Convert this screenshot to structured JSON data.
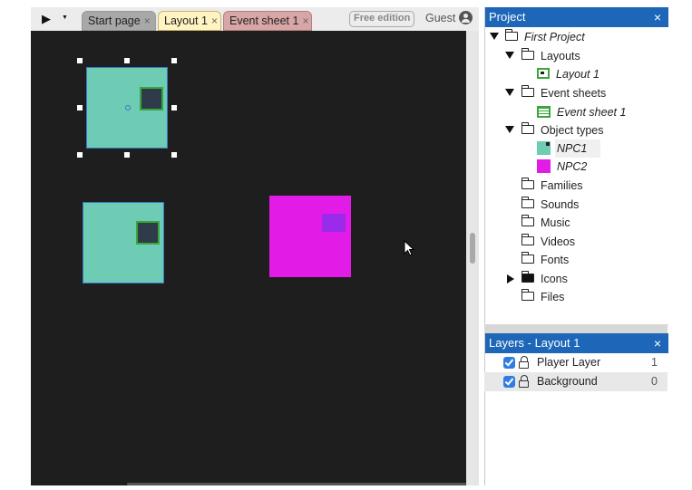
{
  "toolbar": {
    "tabs": [
      {
        "label": "Start page"
      },
      {
        "label": "Layout 1"
      },
      {
        "label": "Event sheet 1"
      }
    ],
    "close_glyph": "×",
    "edition_badge": "Free edition",
    "user": "Guest"
  },
  "project": {
    "title": "Project",
    "close_glyph": "×",
    "root": "First Project",
    "layouts": "Layouts",
    "layout_item": "Layout 1",
    "event_sheets": "Event sheets",
    "event_sheet_item": "Event sheet 1",
    "object_types": "Object types",
    "npc1": "NPC1",
    "npc2": "NPC2",
    "families": "Families",
    "sounds": "Sounds",
    "music": "Music",
    "videos": "Videos",
    "fonts": "Fonts",
    "icons": "Icons",
    "files": "Files"
  },
  "layers": {
    "title": "Layers - Layout 1",
    "close_glyph": "×",
    "items": [
      {
        "name": "Player Layer",
        "index": "1"
      },
      {
        "name": "Background",
        "index": "0"
      }
    ]
  },
  "colors": {
    "npc1": "#6ecbb4",
    "npc2": "#e21ce6",
    "panel_header": "#1e67b8",
    "canvas": "#1e1e1e"
  }
}
